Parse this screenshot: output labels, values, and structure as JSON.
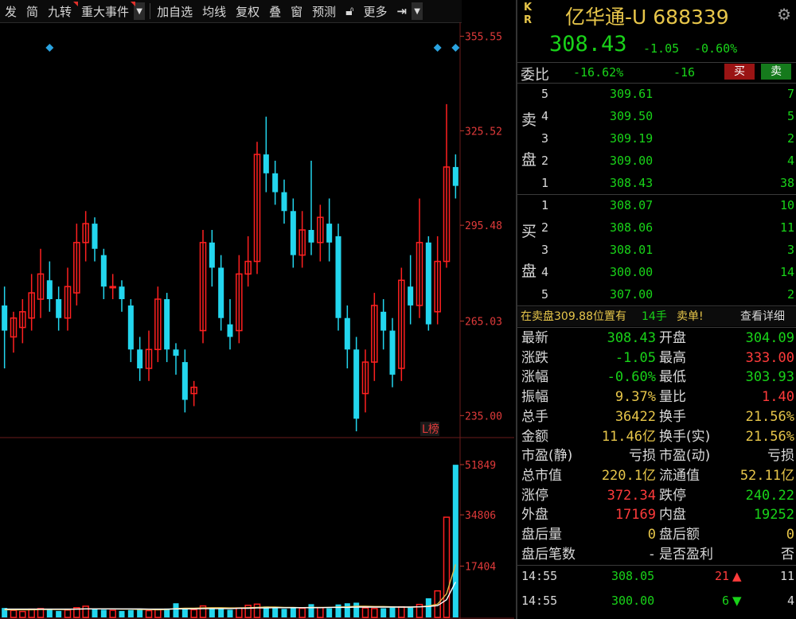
{
  "toolbar": {
    "items": [
      "发",
      "简",
      "九转",
      "重大事件",
      "加自选",
      "均线",
      "复权",
      "叠",
      "窗",
      "预测",
      "更多"
    ],
    "lock_icon": "lock-icon",
    "export_icon": "arrow-to-line-icon"
  },
  "chart": {
    "price_axis": [
      "355.55",
      "325.52",
      "295.48",
      "265.03",
      "235.00"
    ],
    "volume_axis": [
      "51849",
      "34806",
      "17404"
    ],
    "badge": "L榜",
    "colors": {
      "up": "#ff2020",
      "down": "#23d6ee",
      "ma1": "#e3b745",
      "ma2": "#ffffff",
      "grid": "#3a0d0d"
    }
  },
  "chart_data": {
    "type": "candlestick",
    "price_range": [
      228,
      360
    ],
    "candles": [
      [
        270,
        262,
        276,
        250
      ],
      [
        260,
        266,
        268,
        255
      ],
      [
        263,
        268,
        272,
        258
      ],
      [
        266,
        274,
        280,
        262
      ],
      [
        272,
        280,
        288,
        266
      ],
      [
        278,
        272,
        284,
        268
      ],
      [
        272,
        266,
        276,
        262
      ],
      [
        266,
        276,
        282,
        262
      ],
      [
        274,
        290,
        296,
        270
      ],
      [
        290,
        296,
        300,
        284
      ],
      [
        296,
        288,
        298,
        284
      ],
      [
        286,
        276,
        288,
        272
      ],
      [
        276,
        276,
        280,
        272
      ],
      [
        276,
        272,
        278,
        268
      ],
      [
        270,
        256,
        272,
        252
      ],
      [
        256,
        250,
        260,
        246
      ],
      [
        250,
        256,
        262,
        246
      ],
      [
        256,
        272,
        276,
        252
      ],
      [
        272,
        256,
        274,
        252
      ],
      [
        256,
        254,
        258,
        248
      ],
      [
        252,
        240,
        256,
        236
      ],
      [
        242,
        244,
        246,
        238
      ],
      [
        262,
        290,
        294,
        258
      ],
      [
        290,
        282,
        294,
        276
      ],
      [
        282,
        266,
        286,
        262
      ],
      [
        264,
        260,
        272,
        256
      ],
      [
        262,
        280,
        286,
        258
      ],
      [
        280,
        284,
        292,
        276
      ],
      [
        284,
        318,
        322,
        280
      ],
      [
        318,
        312,
        330,
        306
      ],
      [
        312,
        306,
        316,
        302
      ],
      [
        306,
        300,
        310,
        296
      ],
      [
        300,
        286,
        304,
        282
      ],
      [
        286,
        294,
        300,
        282
      ],
      [
        294,
        290,
        316,
        286
      ],
      [
        290,
        298,
        302,
        284
      ],
      [
        296,
        290,
        304,
        284
      ],
      [
        292,
        266,
        296,
        262
      ],
      [
        266,
        256,
        270,
        250
      ],
      [
        256,
        234,
        260,
        230
      ],
      [
        242,
        252,
        256,
        236
      ],
      [
        252,
        270,
        274,
        246
      ],
      [
        268,
        262,
        272,
        256
      ],
      [
        262,
        248,
        266,
        244
      ],
      [
        250,
        278,
        282,
        246
      ],
      [
        276,
        270,
        286,
        264
      ],
      [
        270,
        290,
        304,
        266
      ],
      [
        290,
        264,
        292,
        262
      ],
      [
        268,
        284,
        292,
        264
      ],
      [
        284,
        314,
        334,
        282
      ],
      [
        314,
        308,
        318,
        304
      ]
    ],
    "volumes": [
      3200,
      2400,
      2000,
      2800,
      3000,
      2600,
      2200,
      2500,
      3300,
      3800,
      3000,
      2600,
      2400,
      2200,
      2500,
      2700,
      2300,
      2600,
      3000,
      4800,
      3200,
      2600,
      3900,
      3300,
      2900,
      2600,
      3200,
      4100,
      4500,
      3700,
      3100,
      2900,
      3200,
      3100,
      4500,
      3300,
      3100,
      4400,
      4800,
      5000,
      3200,
      3000,
      3100,
      3300,
      3600,
      3300,
      4400,
      6500,
      9000,
      34000,
      51800
    ],
    "ma1": [
      2600,
      2600,
      2600,
      2600,
      2700,
      2700,
      2700,
      2700,
      2800,
      2900,
      2900,
      2900,
      2900,
      2800,
      2800,
      2700,
      2700,
      2600,
      2700,
      3000,
      3100,
      3100,
      3200,
      3300,
      3300,
      3200,
      3200,
      3300,
      3400,
      3500,
      3500,
      3400,
      3400,
      3300,
      3400,
      3400,
      3400,
      3500,
      3600,
      3800,
      3800,
      3700,
      3700,
      3600,
      3500,
      3500,
      3600,
      3900,
      4500,
      8000,
      18000
    ],
    "ma2": [
      2800,
      2800,
      2800,
      2800,
      2800,
      2800,
      2800,
      2800,
      2800,
      2900,
      2900,
      2900,
      2900,
      2900,
      2900,
      2900,
      2800,
      2800,
      2800,
      2900,
      2900,
      2900,
      3000,
      3000,
      3000,
      3000,
      3100,
      3100,
      3200,
      3200,
      3300,
      3300,
      3300,
      3300,
      3300,
      3300,
      3400,
      3400,
      3400,
      3500,
      3500,
      3500,
      3500,
      3500,
      3500,
      3500,
      3600,
      3700,
      4000,
      6000,
      12000
    ],
    "markers": [
      5,
      48,
      50
    ]
  },
  "quote": {
    "kr": [
      "K",
      "R"
    ],
    "name": "亿华通-U 688339",
    "settings_icon": "gear-icon",
    "price": "308.43",
    "change": "-1.05",
    "change_pct": "-0.60%",
    "weibi_label": "委比",
    "weibi_pct": "-16.62%",
    "weibi_diff": "-16",
    "buy_btn": "买",
    "sell_btn": "卖"
  },
  "orderbook": {
    "sell_label": [
      "卖",
      "盘"
    ],
    "buy_label": [
      "买",
      "盘"
    ],
    "sells": [
      [
        "5",
        "309.61",
        "7"
      ],
      [
        "4",
        "309.50",
        "5"
      ],
      [
        "3",
        "309.19",
        "2"
      ],
      [
        "2",
        "309.00",
        "4"
      ],
      [
        "1",
        "308.43",
        "38"
      ]
    ],
    "buys": [
      [
        "1",
        "308.07",
        "10"
      ],
      [
        "2",
        "308.06",
        "11"
      ],
      [
        "3",
        "308.01",
        "3"
      ],
      [
        "4",
        "300.00",
        "14"
      ],
      [
        "5",
        "307.00",
        "2"
      ]
    ]
  },
  "notice": {
    "text1": "在卖盘309.88位置有",
    "text2": "14手",
    "text3": "卖单!",
    "link": "查看详细"
  },
  "details": [
    [
      "最新",
      "308.43",
      "g",
      "开盘",
      "304.09",
      "g"
    ],
    [
      "涨跌",
      "-1.05",
      "g",
      "最高",
      "333.00",
      "r"
    ],
    [
      "涨幅",
      "-0.60%",
      "g",
      "最低",
      "303.93",
      "g"
    ],
    [
      "振幅",
      "9.37%",
      "y",
      "量比",
      "1.40",
      "r"
    ],
    [
      "总手",
      "36422",
      "y",
      "换手",
      "21.56%",
      "y"
    ],
    [
      "金额",
      "11.46亿",
      "y",
      "换手(实)",
      "21.56%",
      "y"
    ],
    [
      "市盈(静)",
      "亏损",
      "w",
      "市盈(动)",
      "亏损",
      "w"
    ],
    [
      "总市值",
      "220.1亿",
      "y",
      "流通值",
      "52.11亿",
      "y"
    ],
    [
      "涨停",
      "372.34",
      "r",
      "跌停",
      "240.22",
      "g"
    ],
    [
      "外盘",
      "17169",
      "r",
      "内盘",
      "19252",
      "g"
    ],
    [
      "盘后量",
      "0",
      "y",
      "盘后额",
      "0",
      "y"
    ],
    [
      "盘后笔数",
      "-",
      "w",
      "是否盈利",
      "否",
      "w"
    ]
  ],
  "ticks": [
    [
      "14:55",
      "308.05",
      "21",
      "up",
      "11"
    ],
    [
      "14:55",
      "300.00",
      "6",
      "down",
      "4"
    ]
  ]
}
